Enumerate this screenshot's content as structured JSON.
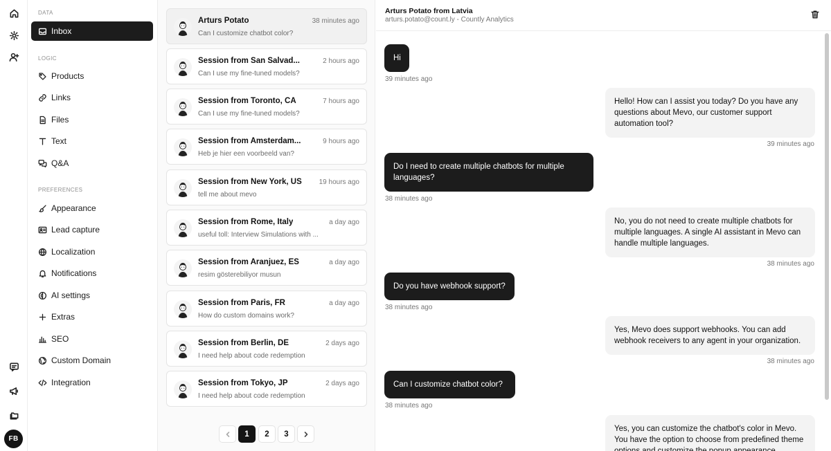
{
  "rail": {
    "avatar_initials": "FB"
  },
  "sidebar": {
    "sections": {
      "data": "DATA",
      "logic": "LOGIC",
      "preferences": "PREFERENCES"
    },
    "items": {
      "inbox": "Inbox",
      "products": "Products",
      "links": "Links",
      "files": "Files",
      "text": "Text",
      "qa": "Q&A",
      "appearance": "Appearance",
      "lead_capture": "Lead capture",
      "localization": "Localization",
      "notifications": "Notifications",
      "ai_settings": "AI settings",
      "extras": "Extras",
      "seo": "SEO",
      "custom_domain": "Custom Domain",
      "integration": "Integration"
    }
  },
  "sessions": [
    {
      "title": "Arturs Potato",
      "time": "38 minutes ago",
      "preview": "Can I customize chatbot color?"
    },
    {
      "title": "Session from San Salvad...",
      "time": "2 hours ago",
      "preview": "Can I use my fine-tuned models?"
    },
    {
      "title": "Session from Toronto, CA",
      "time": "7 hours ago",
      "preview": "Can I use my fine-tuned models?"
    },
    {
      "title": "Session from Amsterdam...",
      "time": "9 hours ago",
      "preview": "Heb je hier een voorbeeld van?"
    },
    {
      "title": "Session from New York, US",
      "time": "19 hours ago",
      "preview": "tell me about mevo"
    },
    {
      "title": "Session from Rome, Italy",
      "time": "a day ago",
      "preview": "useful toll: Interview Simulations with ..."
    },
    {
      "title": "Session from Aranjuez, ES",
      "time": "a day ago",
      "preview": "resim gösterebiliyor musun"
    },
    {
      "title": "Session from Paris, FR",
      "time": "a day ago",
      "preview": "How do custom domains work?"
    },
    {
      "title": "Session from Berlin, DE",
      "time": "2 days ago",
      "preview": "I need help about code redemption"
    },
    {
      "title": "Session from Tokyo, JP",
      "time": "2 days ago",
      "preview": "I need help about code redemption"
    }
  ],
  "pagination": {
    "pages": [
      "1",
      "2",
      "3"
    ],
    "current": "1"
  },
  "chat": {
    "title": "Arturs Potato from Latvia",
    "subtitle": "arturs.potato@count.ly - Countly Analytics",
    "messages": [
      {
        "role": "user",
        "text": "Hi",
        "time": "39 minutes ago"
      },
      {
        "role": "bot",
        "text": "Hello! How can I assist you today? Do you have any questions about Mevo, our customer support automation tool?",
        "time": "39 minutes ago"
      },
      {
        "role": "user",
        "text": "Do I need to create multiple chatbots for multiple languages?",
        "time": "38 minutes ago"
      },
      {
        "role": "bot",
        "text": "No, you do not need to create multiple chatbots for multiple languages. A single AI assistant in Mevo can handle multiple languages.",
        "time": "38 minutes ago"
      },
      {
        "role": "user",
        "text": "Do you have webhook support?",
        "time": "38 minutes ago"
      },
      {
        "role": "bot",
        "text": "Yes, Mevo does support webhooks. You can add webhook receivers to any agent in your organization.",
        "time": "38 minutes ago"
      },
      {
        "role": "user",
        "text": "Can I customize chatbot color?",
        "time": "38 minutes ago"
      },
      {
        "role": "bot",
        "text": "Yes, you can customize the chatbot's color in Mevo. You have the option to choose from predefined theme options and customize the popup appearance",
        "time": ""
      }
    ]
  }
}
